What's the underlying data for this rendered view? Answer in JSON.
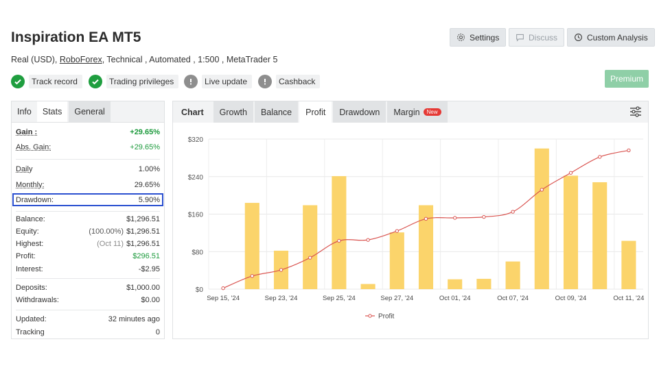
{
  "header": {
    "title": "Inspiration EA MT5",
    "account_type": "Real (USD),",
    "broker": "RoboForex",
    "details": ", Technical , Automated , 1:500 , MetaTrader 5"
  },
  "top_buttons": {
    "settings": "Settings",
    "discuss": "Discuss",
    "custom_analysis": "Custom Analysis",
    "premium": "Premium"
  },
  "badges": {
    "track_record": "Track record",
    "trading_privileges": "Trading privileges",
    "live_update": "Live update",
    "cashback": "Cashback"
  },
  "left_tabs": [
    "Info",
    "Stats",
    "General"
  ],
  "stats": {
    "gain_label": "Gain :",
    "gain": "+29.65%",
    "abs_gain_label": "Abs. Gain:",
    "abs_gain": "+29.65%",
    "daily_label": "Daily",
    "daily": "1.00%",
    "monthly_label": "Monthly:",
    "monthly": "29.65%",
    "drawdown_label": "Drawdown:",
    "drawdown": "5.90%",
    "balance_label": "Balance:",
    "balance": "$1,296.51",
    "equity_label": "Equity:",
    "equity_pct": "(100.00%)",
    "equity": "$1,296.51",
    "highest_label": "Highest:",
    "highest_date": "(Oct 11)",
    "highest": "$1,296.51",
    "profit_label": "Profit:",
    "profit": "$296.51",
    "interest_label": "Interest:",
    "interest": "-$2.95",
    "deposits_label": "Deposits:",
    "deposits": "$1,000.00",
    "withdrawals_label": "Withdrawals:",
    "withdrawals": "$0.00",
    "updated_label": "Updated:",
    "updated": "32 minutes ago",
    "tracking_label": "Tracking",
    "tracking": "0"
  },
  "chart_tabs": {
    "chart": "Chart",
    "growth": "Growth",
    "balance": "Balance",
    "profit": "Profit",
    "drawdown": "Drawdown",
    "margin": "Margin",
    "new": "New"
  },
  "colors": {
    "bar": "#fbd46b",
    "line": "#d9534f",
    "green": "#1c9a3c",
    "premium": "#8fcfa7"
  },
  "chart_data": {
    "type": "bar",
    "title": "",
    "ylim": [
      0,
      320
    ],
    "y_ticks": [
      "$0",
      "$80",
      "$160",
      "$240",
      "$320"
    ],
    "x_tick_labels": [
      "Sep 15, '24",
      "Sep 23, '24",
      "Sep 25, '24",
      "Sep 27, '24",
      "Oct 01, '24",
      "Oct 07, '24",
      "Oct 09, '24",
      "Oct 11, '24"
    ],
    "legend": "Profit",
    "bars": [
      0,
      184,
      82,
      179,
      241,
      11,
      121,
      179,
      21,
      22,
      59,
      300,
      242,
      228,
      103
    ],
    "line": [
      2,
      28,
      41,
      67,
      103,
      105,
      124,
      150,
      152,
      154,
      165,
      212,
      248,
      282,
      296
    ]
  }
}
